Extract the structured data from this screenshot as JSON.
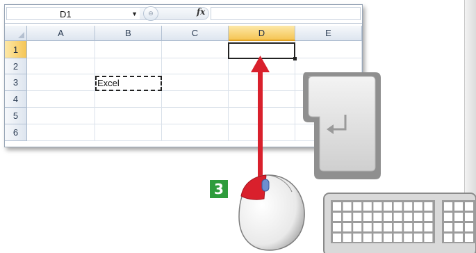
{
  "spreadsheet": {
    "name_box": "D1",
    "fx_label": "fx",
    "formula_value": "",
    "columns": [
      "A",
      "B",
      "C",
      "D",
      "E"
    ],
    "rows": [
      "1",
      "2",
      "3",
      "4",
      "5",
      "6"
    ],
    "selected_cell": "D1",
    "copied_cell": {
      "ref": "B3",
      "value": "Excel"
    }
  },
  "step": {
    "number": "3"
  },
  "icons": {
    "enter_key": "enter-key-icon",
    "mouse": "mouse-icon",
    "keyboard": "keyboard-icon",
    "arrow": "red-arrow-icon"
  },
  "colors": {
    "step_badge": "#2e9c3c",
    "arrow": "#d9202c",
    "selected_header": "#f5c555"
  }
}
